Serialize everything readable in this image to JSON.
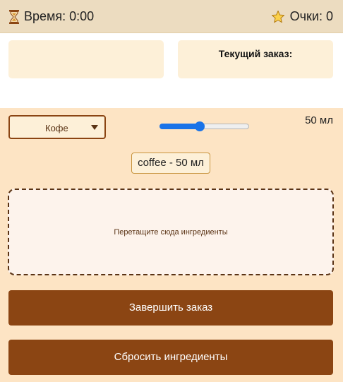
{
  "header": {
    "timer_label": "Время: 0:00",
    "score_label": "Очки: 0",
    "timer_icon": "hourglass-icon",
    "score_icon": "star-icon"
  },
  "order": {
    "title": "Текущий заказ:"
  },
  "ingredient_select": {
    "selected": "Кофе"
  },
  "volume": {
    "readout": "50 мл",
    "slider_fraction": 0.45
  },
  "selected_ingredient": {
    "label": "coffee - 50 мл"
  },
  "dropzone": {
    "hint": "Перетащите сюда ингредиенты"
  },
  "buttons": {
    "complete": "Завершить заказ",
    "reset": "Сбросить ингредиенты"
  },
  "colors": {
    "header_bg": "#ecdcc0",
    "panel_bg": "#fde4c4",
    "card_bg": "#fdf0d8",
    "accent_brown": "#8b4513",
    "slider_blue": "#1a73e8"
  }
}
